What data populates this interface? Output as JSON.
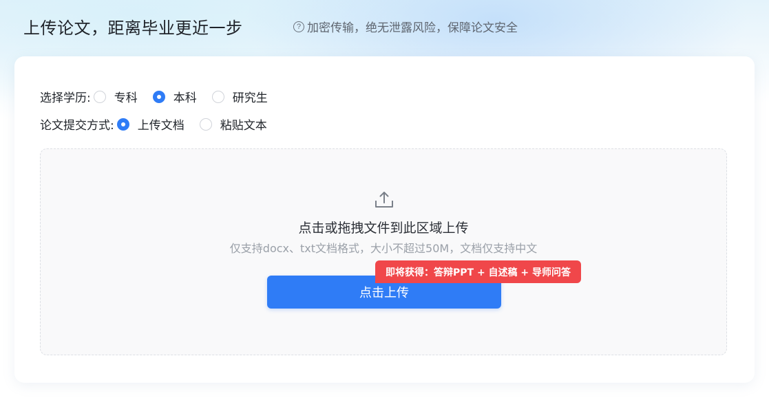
{
  "header": {
    "title": "上传论文，距离毕业更近一步",
    "help_icon": "question-circle-icon",
    "subtitle": "加密传输，绝无泄露风险，保障论文安全"
  },
  "form": {
    "education": {
      "label": "选择学历:",
      "options": [
        {
          "label": "专科",
          "checked": false
        },
        {
          "label": "本科",
          "checked": true
        },
        {
          "label": "研究生",
          "checked": false
        }
      ]
    },
    "method": {
      "label": "论文提交方式:",
      "options": [
        {
          "label": "上传文档",
          "checked": true
        },
        {
          "label": "粘贴文本",
          "checked": false
        }
      ]
    }
  },
  "upload": {
    "icon": "upload-icon",
    "title": "点击或拖拽文件到此区域上传",
    "hint": "仅支持docx、txt文档格式，大小不超过50M，文档仅支持中文",
    "button_label": "点击上传",
    "promo": "即将获得：答辩PPT + 自述稿 + 导师问答"
  },
  "colors": {
    "accent": "#2f7cf6",
    "promo": "#f0474a"
  }
}
